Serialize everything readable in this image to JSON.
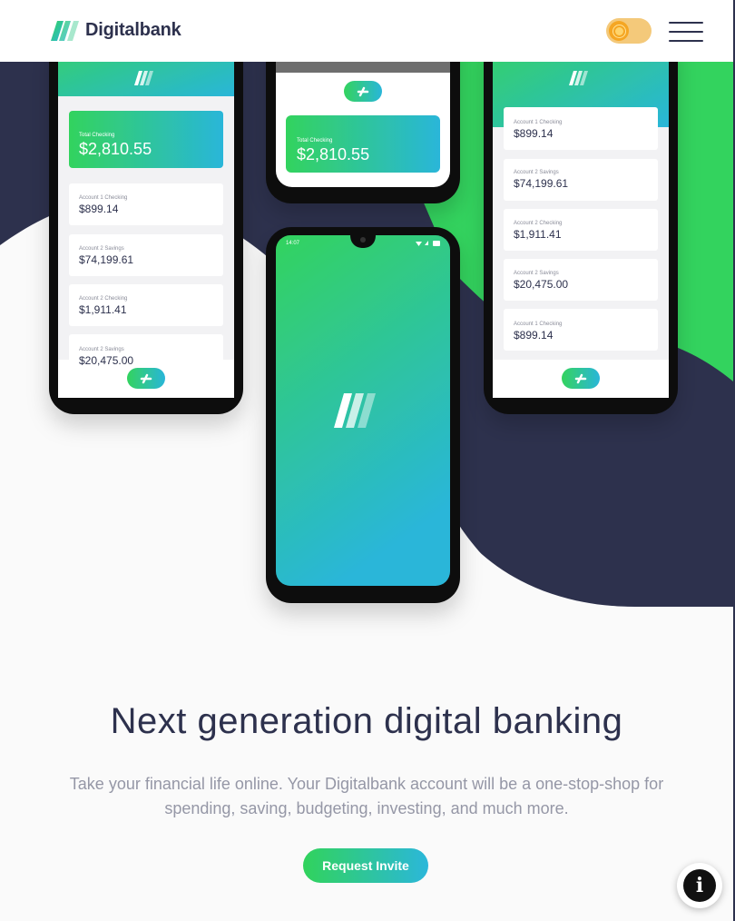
{
  "header": {
    "brand": "Digitalbank",
    "theme_toggle_icon": "sun-icon",
    "menu_icon": "hamburger-menu-icon"
  },
  "phones": {
    "left": {
      "total_label": "Total Checking",
      "total_value": "$2,810.55",
      "accounts": [
        {
          "label": "Account 1 Checking",
          "value": "$899.14"
        },
        {
          "label": "Account 2 Savings",
          "value": "$74,199.61"
        },
        {
          "label": "Account 2 Checking",
          "value": "$1,911.41"
        },
        {
          "label": "Account 2 Savings",
          "value": "$20,475.00"
        }
      ]
    },
    "middle_top": {
      "total_label": "Total Checking",
      "total_value": "$2,810.55"
    },
    "center": {
      "status_time": "14:07"
    },
    "right": {
      "accounts": [
        {
          "label": "Account 1 Checking",
          "value": "$899.14"
        },
        {
          "label": "Account 2 Savings",
          "value": "$74,199.61"
        },
        {
          "label": "Account 2 Checking",
          "value": "$1,911.41"
        },
        {
          "label": "Account 2 Savings",
          "value": "$20,475.00"
        },
        {
          "label": "Account 1 Checking",
          "value": "$899.14"
        }
      ]
    }
  },
  "main": {
    "headline": "Next generation digital banking",
    "subtext": "Take your financial life online. Your Digitalbank account will be a one-stop-shop for spending, saving, budgeting, investing, and much more.",
    "cta_label": "Request Invite"
  },
  "info_button": {
    "icon": "info-icon",
    "glyph": "i"
  },
  "colors": {
    "dark_blue": "#2d314d",
    "lime_green": "#31d35c",
    "bright_cyan": "#2bb7da",
    "grayish_blue": "#9597a6",
    "very_light_gray": "#fafafa"
  }
}
